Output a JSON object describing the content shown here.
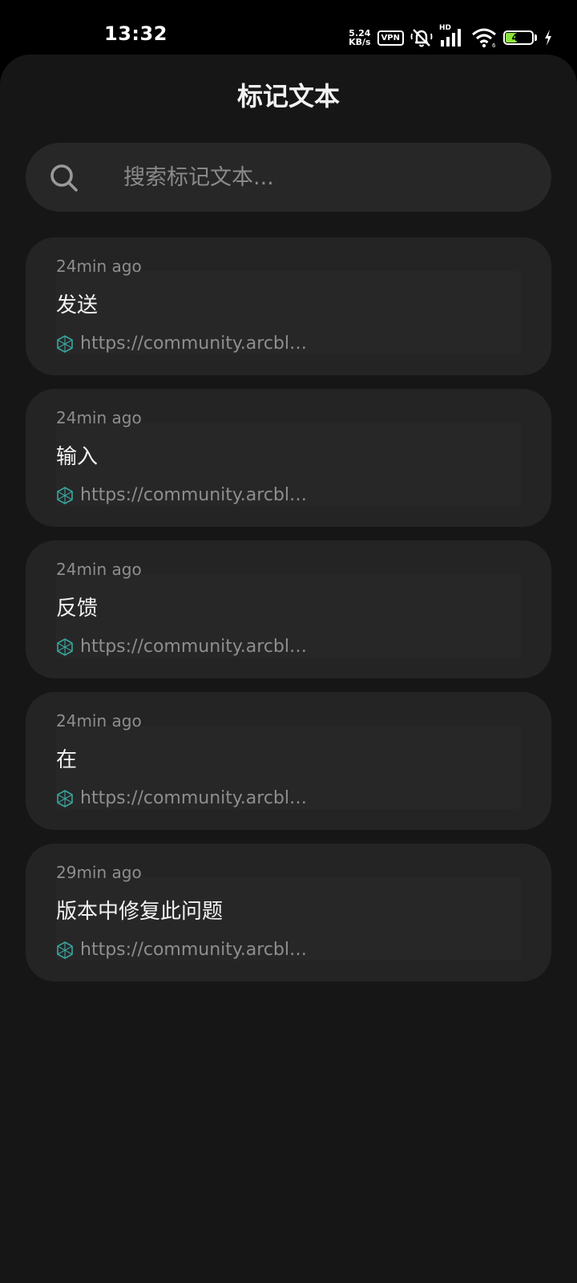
{
  "status_bar": {
    "time": "13:32",
    "net_speed_value": "5.24",
    "net_speed_unit": "KB/s",
    "vpn_label": "VPN",
    "signal_tag": "HD",
    "battery_level": "48",
    "battery_percent": 48,
    "battery_color": "#8ee33c",
    "icons": [
      "vpn-icon",
      "mute-bell-icon",
      "signal-icon",
      "wifi-icon",
      "battery-icon",
      "charging-bolt-icon"
    ]
  },
  "page": {
    "title": "标记文本"
  },
  "search": {
    "placeholder": "搜索标记文本...",
    "value": ""
  },
  "cards": [
    {
      "time": "24min ago",
      "text": "发送",
      "source": "https://community.arcbl…"
    },
    {
      "time": "24min ago",
      "text": "输入",
      "source": "https://community.arcbl…"
    },
    {
      "time": "24min ago",
      "text": "反馈",
      "source": "https://community.arcbl…"
    },
    {
      "time": "24min ago",
      "text": "在",
      "source": "https://community.arcbl…"
    },
    {
      "time": "29min ago",
      "text": "版本中修复此问题",
      "source": "https://community.arcbl…"
    }
  ],
  "colors": {
    "background": "#161616",
    "card": "#242424",
    "accent": "#3aa6a0"
  }
}
